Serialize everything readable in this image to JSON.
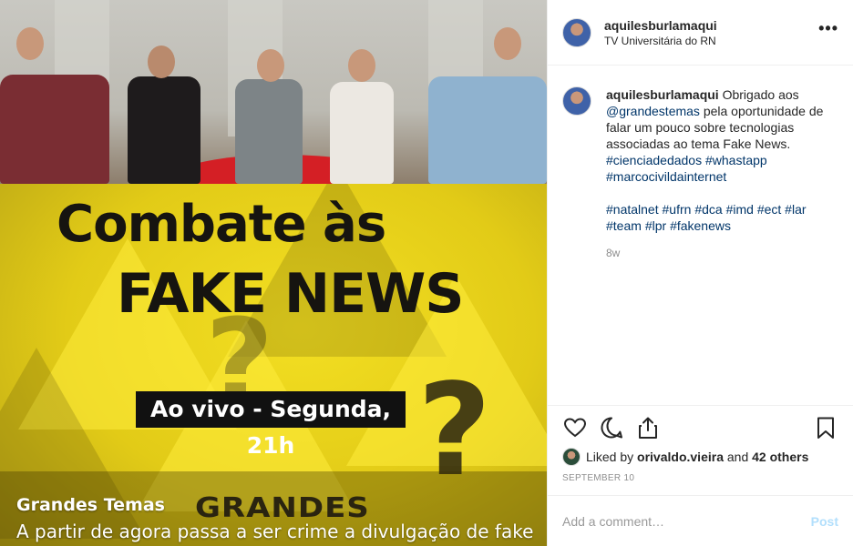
{
  "post": {
    "username": "aquilesburlamaqui",
    "location": "TV Universitária do RN",
    "more_label": "•••"
  },
  "media": {
    "headline_line1": "Combate às",
    "headline_line2": "FAKE NEWS",
    "live_label": "Ao vivo - Segunda, 21h",
    "logo_text": "GRANDES",
    "question_mark": "?",
    "caption_title": "Grandes Temas",
    "caption_text": "A partir de agora passa a ser crime a divulgação de fake"
  },
  "comment": {
    "username": "aquilesburlamaqui",
    "text_1": " Obrigado aos ",
    "mention": "@grandestemas",
    "text_2": " pela oportunidade de falar um pouco sobre tecnologias associadas ao tema Fake News. ",
    "tags_line1": [
      "#cienciadedados",
      "#whastapp",
      "#marcocivildainternet"
    ],
    "tags_line2": [
      "#natalnet",
      "#ufrn",
      "#dca",
      "#imd",
      "#ect",
      "#lar",
      "#team",
      "#lpr",
      "#fakenews"
    ],
    "age": "8w"
  },
  "engagement": {
    "liked_by_prefix": "Liked by ",
    "liked_by_user": "orivaldo.vieira",
    "liked_by_middle": " and ",
    "liked_by_others": "42 others",
    "date": "SEPTEMBER 10"
  },
  "add_comment": {
    "placeholder": "Add a comment…",
    "post_label": "Post"
  },
  "icons": [
    "heart-icon",
    "comment-icon",
    "share-icon",
    "bookmark-icon",
    "more-icon"
  ],
  "colors": {
    "text": "#262626",
    "link": "#003569",
    "muted": "#8e8e8e",
    "post_disabled": "#b2dffc",
    "banner_yellow": "#e2cb17"
  }
}
